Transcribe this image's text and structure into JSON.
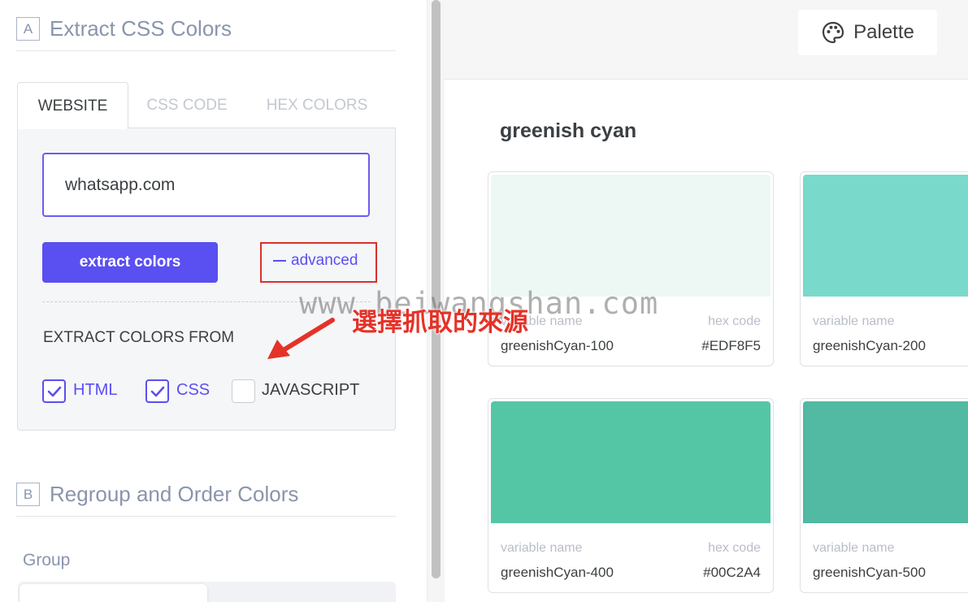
{
  "sidebar": {
    "section_a": {
      "letter": "A",
      "title": "Extract CSS Colors"
    },
    "tabs": [
      {
        "label": "WEBSITE",
        "active": true
      },
      {
        "label": "CSS CODE",
        "active": false
      },
      {
        "label": "HEX COLORS",
        "active": false
      }
    ],
    "url_input": {
      "value": "whatsapp.com"
    },
    "extract_button": "extract colors",
    "advanced_link": "advanced",
    "extract_from_label": "EXTRACT COLORS FROM",
    "sources": [
      {
        "label": "HTML",
        "checked": true
      },
      {
        "label": "CSS",
        "checked": true
      },
      {
        "label": "JAVASCRIPT",
        "checked": false
      }
    ],
    "section_b": {
      "letter": "B",
      "title": "Regroup and Order Colors"
    },
    "group_label": "Group"
  },
  "toolbar": {
    "palette_button": "Palette",
    "palette_icon": "palette-icon"
  },
  "main": {
    "group_title": "greenish cyan",
    "cards": [
      {
        "swatch": "#EDF8F5",
        "name_key": "variable name",
        "name": "greenishCyan-100",
        "hex_key": "hex code",
        "hex": "#EDF8F5"
      },
      {
        "swatch": "#79D9CB",
        "name_key": "variable name",
        "name": "greenishCyan-200",
        "hex_key": "",
        "hex": ""
      },
      {
        "swatch": "#54C6A6",
        "name_key": "variable name",
        "name": "greenishCyan-400",
        "hex_key": "hex code",
        "hex": "#00C2A4"
      },
      {
        "swatch": "#52B9A2",
        "name_key": "variable name",
        "name": "greenishCyan-500",
        "hex_key": "",
        "hex": ""
      }
    ]
  },
  "overlay": {
    "watermark": "www.beiwangshan.com",
    "annotation": "選擇抓取的來源"
  },
  "colors": {
    "accent": "#5A4FF0",
    "highlight_box": "#D9312C",
    "annotation": "#E53228"
  }
}
